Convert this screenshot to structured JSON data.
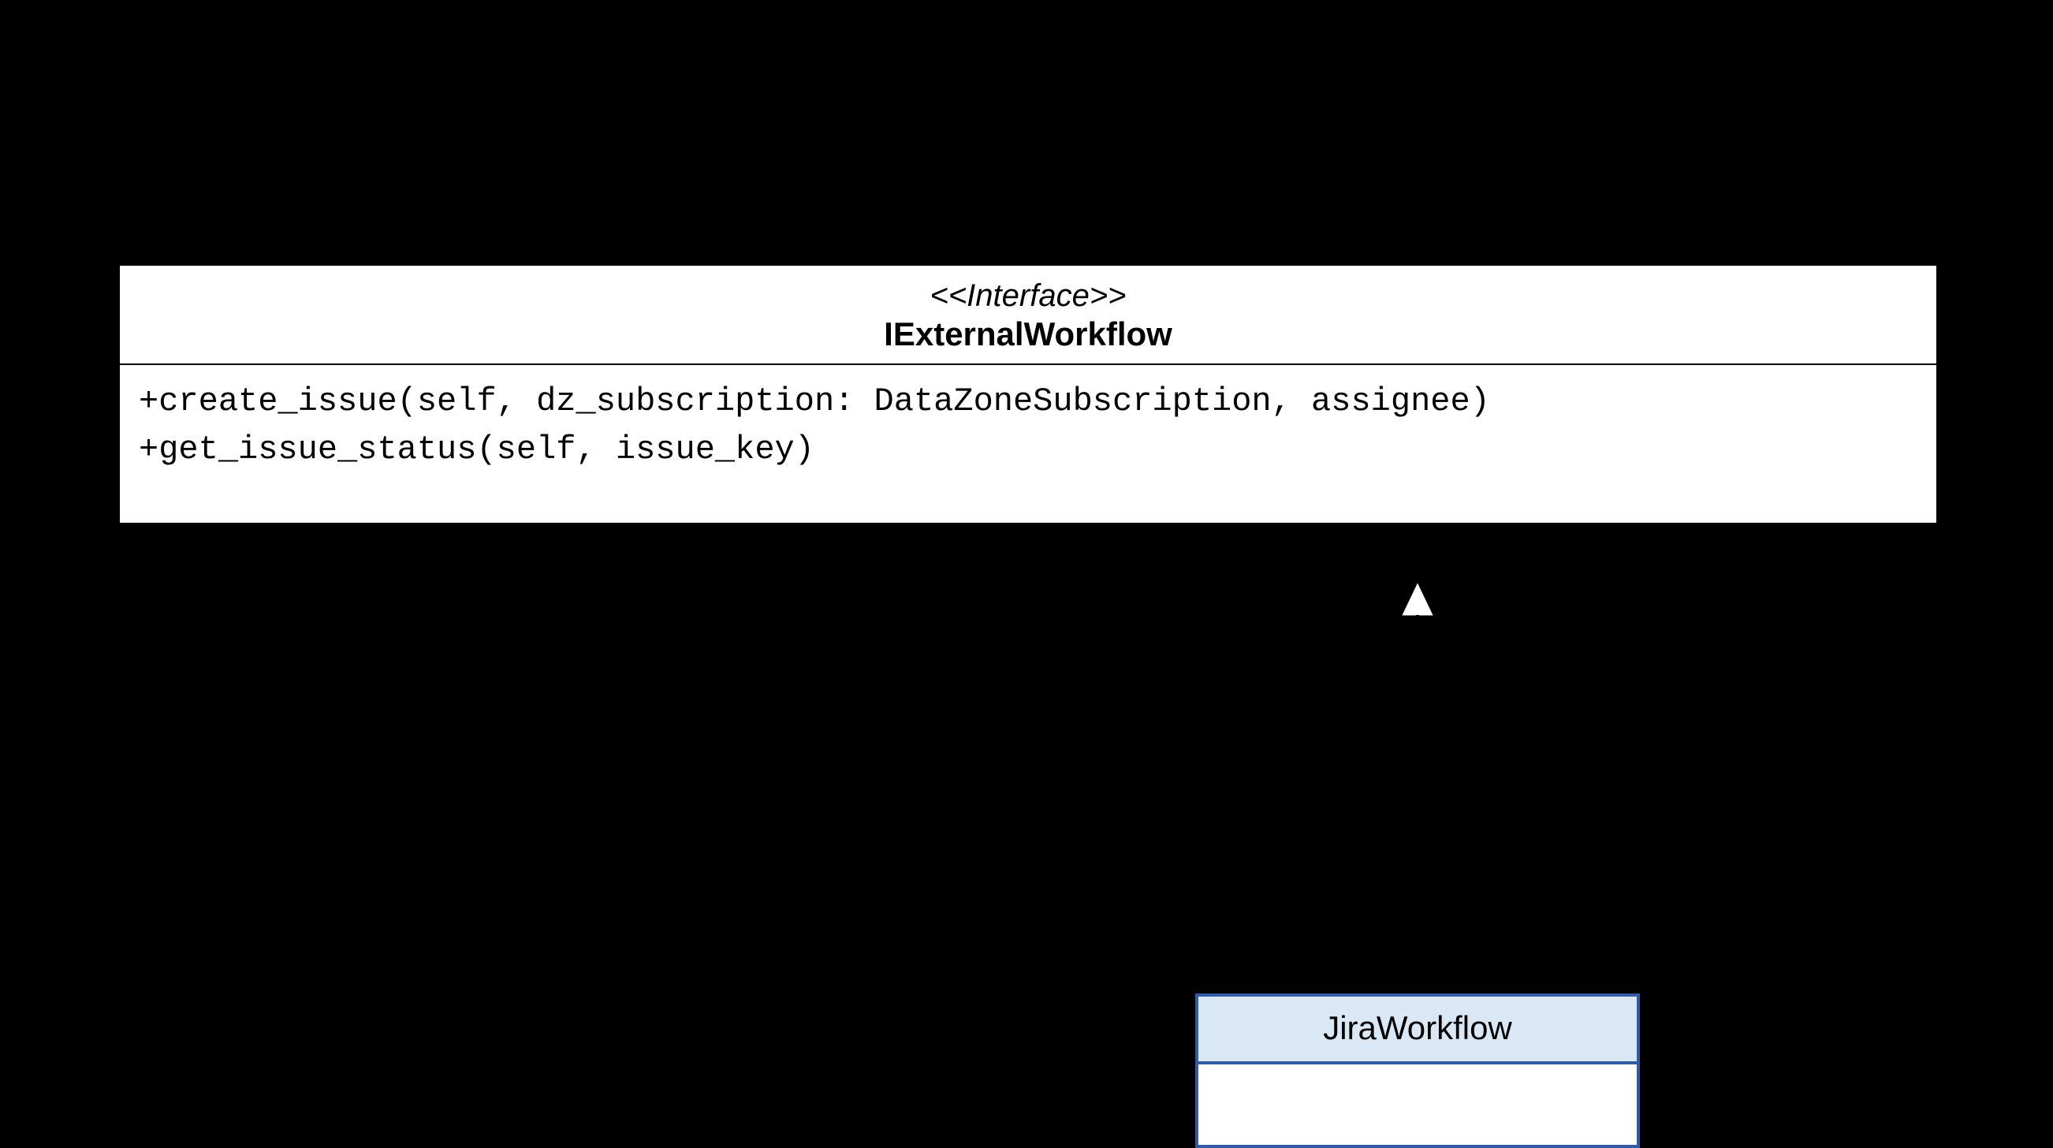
{
  "interface": {
    "stereotype": "<<Interface>>",
    "name": "IExternalWorkflow",
    "methods": [
      "+create_issue(self, dz_subscription: DataZoneSubscription, assignee)",
      "+get_issue_status(self, issue_key)"
    ]
  },
  "child": {
    "name": "JiraWorkflow"
  },
  "chart_data": {
    "type": "diagram",
    "diagram_type": "uml-class",
    "elements": [
      {
        "id": "IExternalWorkflow",
        "kind": "interface",
        "stereotype": "<<Interface>>",
        "name": "IExternalWorkflow",
        "methods": [
          {
            "visibility": "+",
            "signature": "create_issue(self, dz_subscription: DataZoneSubscription, assignee)"
          },
          {
            "visibility": "+",
            "signature": "get_issue_status(self, issue_key)"
          }
        ]
      },
      {
        "id": "JiraWorkflow",
        "kind": "class",
        "name": "JiraWorkflow"
      }
    ],
    "relationships": [
      {
        "from": "JiraWorkflow",
        "to": "IExternalWorkflow",
        "type": "realization",
        "line_style": "dashed",
        "arrowhead": "open-triangle"
      }
    ]
  }
}
